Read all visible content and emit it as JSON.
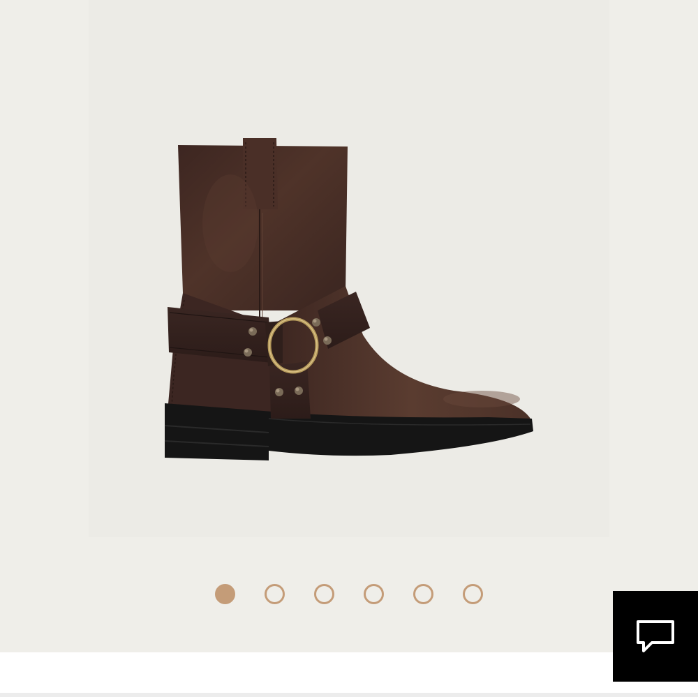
{
  "gallery": {
    "image_alt": "",
    "slide_count": 6,
    "active_slide": 1,
    "dots": [
      {
        "state": "active"
      },
      {
        "state": "inactive"
      },
      {
        "state": "inactive"
      },
      {
        "state": "inactive"
      },
      {
        "state": "inactive"
      },
      {
        "state": "inactive"
      }
    ]
  },
  "chat": {
    "icon": "chat-bubble-icon"
  },
  "colors": {
    "background": "#efeee9",
    "image_panel": "#ecebe6",
    "dot_accent": "#c49c78",
    "chat_button": "#000000",
    "boot_leather": "#4a3027",
    "boot_sole": "#141414",
    "hardware_brass": "#b59a5c"
  }
}
